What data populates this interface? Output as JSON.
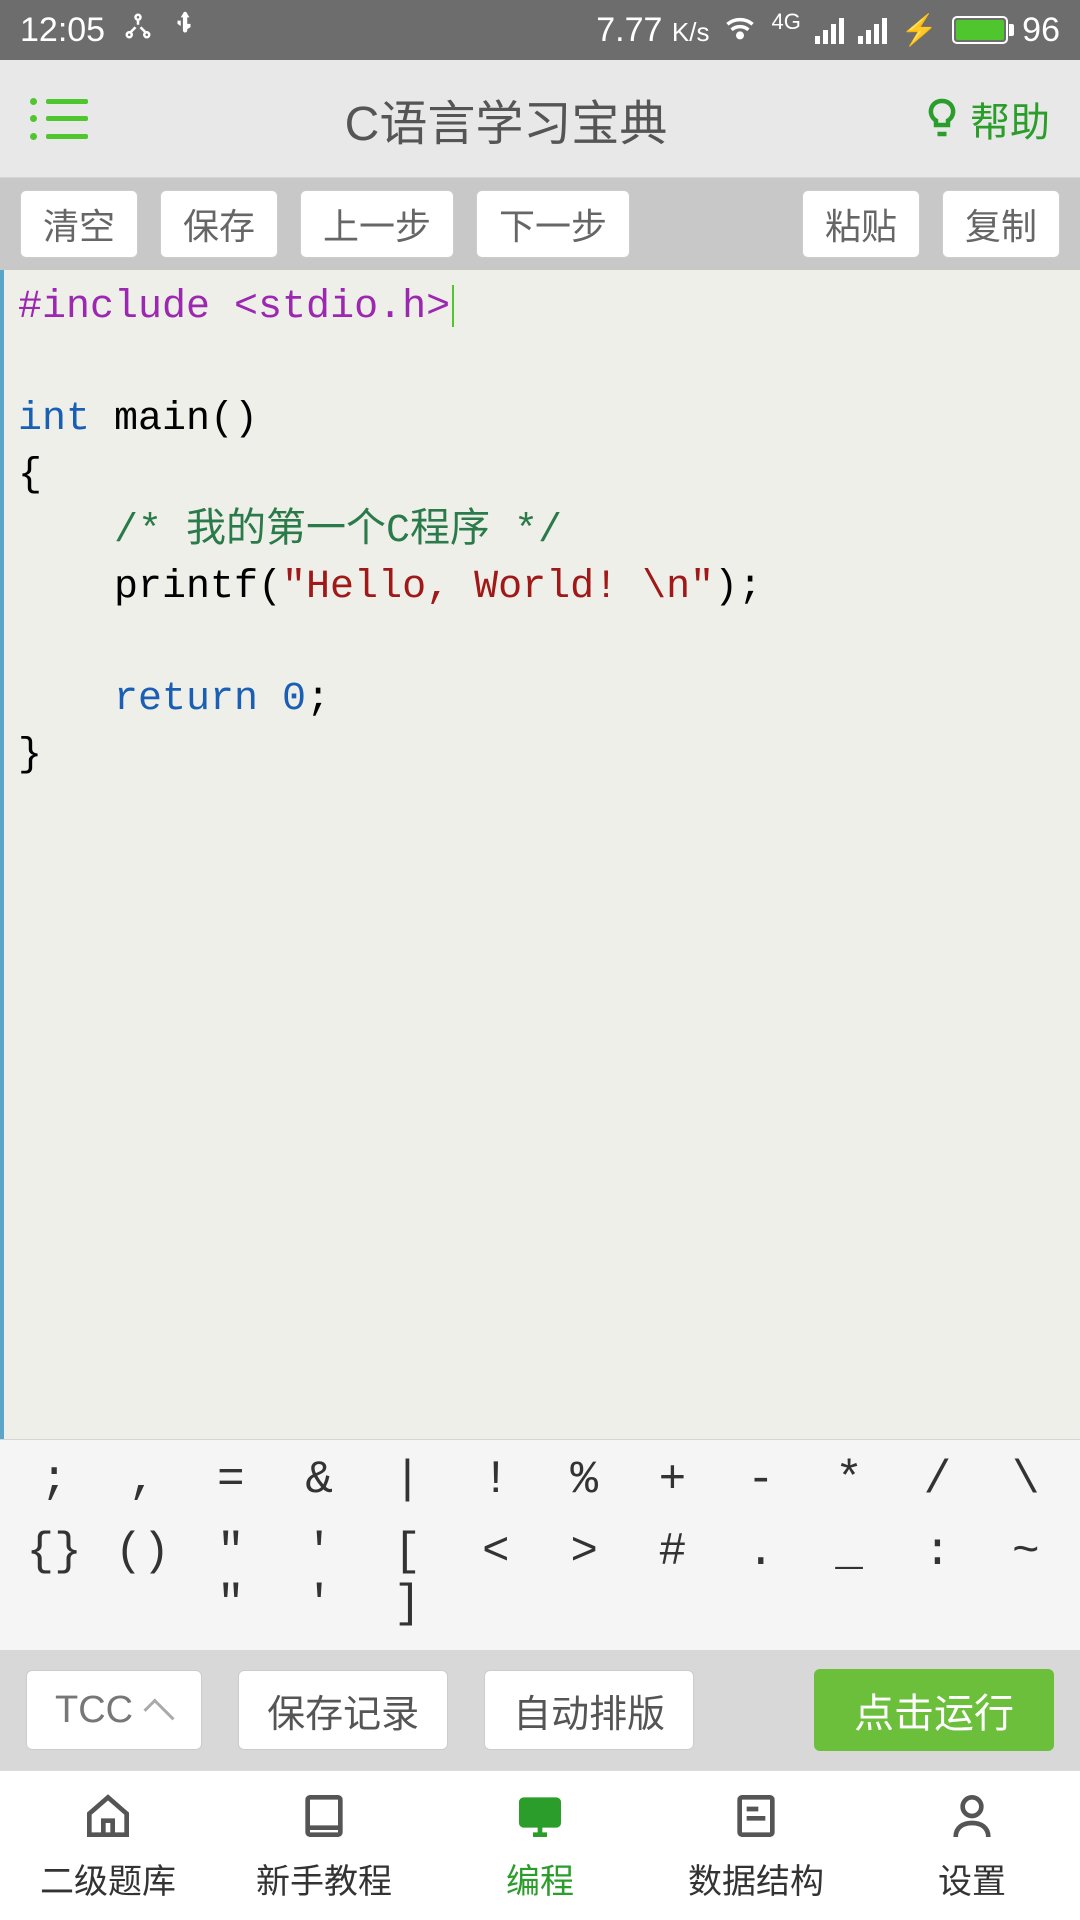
{
  "status": {
    "time": "12:05",
    "netspeed": "7.77",
    "netspeed_unit": "K/s",
    "net_type": "4G",
    "battery_pct": "96"
  },
  "header": {
    "title": "C语言学习宝典",
    "help_label": "帮助"
  },
  "toolbar": {
    "clear": "清空",
    "save": "保存",
    "undo": "上一步",
    "redo": "下一步",
    "paste": "粘贴",
    "copy": "复制"
  },
  "code": {
    "line1_directive": "#include",
    "line1_header": "<stdio.h>",
    "line3_kw": "int",
    "line3_fn": " main()",
    "line4": "{",
    "line5_comment": "/* 我的第一个C程序 */",
    "line6_pre": "printf(",
    "line6_str": "\"Hello, World! \\n\"",
    "line6_post": ");",
    "line8_kw": "return",
    "line8_num": " 0",
    "line8_post": ";",
    "line9": "}"
  },
  "symbols": {
    "row1": [
      ";",
      ",",
      "=",
      "&",
      "|",
      "!",
      "%",
      "+",
      "-",
      "*",
      "/",
      "\\"
    ],
    "row2": [
      "{}",
      "()",
      "\" \"",
      "' '",
      "[ ]",
      "<",
      ">",
      "#",
      ".",
      "_",
      ":",
      "~"
    ]
  },
  "actions": {
    "compiler": "TCC",
    "save_record": "保存记录",
    "auto_format": "自动排版",
    "run": "点击运行"
  },
  "nav": {
    "items": [
      {
        "label": "二级题库"
      },
      {
        "label": "新手教程"
      },
      {
        "label": "编程"
      },
      {
        "label": "数据结构"
      },
      {
        "label": "设置"
      }
    ],
    "active_index": 2
  }
}
